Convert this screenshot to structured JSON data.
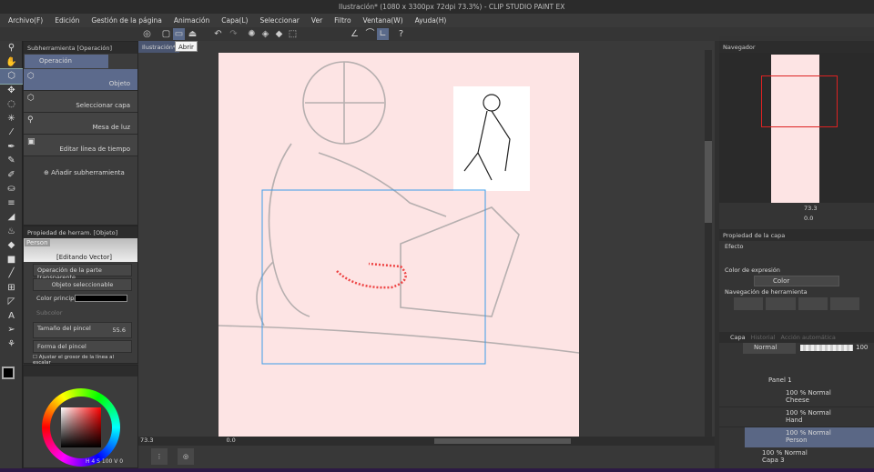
{
  "window": {
    "title": "Ilustración* (1080 x 3300px 72dpi 73.3%) - CLIP STUDIO PAINT EX"
  },
  "menu": [
    "Archivo(F)",
    "Edición",
    "Gestión de la página",
    "Animación",
    "Capa(L)",
    "Seleccionar",
    "Ver",
    "Filtro",
    "Ventana(W)",
    "Ayuda(H)"
  ],
  "canvas_tab": {
    "label": "Ilustración*",
    "tooltip": "Abrir"
  },
  "subtool": {
    "title": "Subherramienta [Operación]",
    "group": "Operación",
    "items": [
      {
        "label": "Objeto",
        "selected": true
      },
      {
        "label": "Seleccionar capa"
      },
      {
        "label": "Mesa de luz"
      },
      {
        "label": "Editar línea de tiempo"
      }
    ],
    "add": "Añadir subherramienta"
  },
  "toolprop": {
    "title": "Propiedad de herram. [Objeto]",
    "layer_name": "Person",
    "mode": "[Editando Vector]",
    "transparent_op": "Operación de la parte transparente",
    "selectable": "Objeto seleccionable",
    "main_color": "Color principal",
    "subcolor": "Subcolor",
    "brush_size_label": "Tamaño del pincel",
    "brush_size": "55.6",
    "brush_shape": "Forma del pincel",
    "adjust_line": "Ajustar el grosor de la línea al escalar"
  },
  "color": {
    "main": "#000000",
    "sub": "#000000",
    "readout": [
      "4",
      "100",
      "0"
    ]
  },
  "status": {
    "zoom": "73.3",
    "angle": "0.0"
  },
  "navigator": {
    "tab": "Navegador",
    "zoom": "73.3",
    "angle": "0.0"
  },
  "layerprop": {
    "tab": "Propiedad de la capa",
    "effect": "Efecto",
    "expr_label": "Color de expresión",
    "expr_value": "Color",
    "nav": "Navegación de herramienta"
  },
  "layers": {
    "tabs": [
      "Capa",
      "Historial",
      "Acción automática"
    ],
    "blend": "Normal",
    "opacity": "100",
    "items": [
      {
        "name": "Panel 1",
        "info": "",
        "folder": true
      },
      {
        "name": "Cheese",
        "info": "100 % Normal"
      },
      {
        "name": "Hand",
        "info": "100 % Normal"
      },
      {
        "name": "Person",
        "info": "100 % Normal",
        "selected": true
      },
      {
        "name": "Capa 3",
        "info": "100 % Normal"
      }
    ]
  }
}
